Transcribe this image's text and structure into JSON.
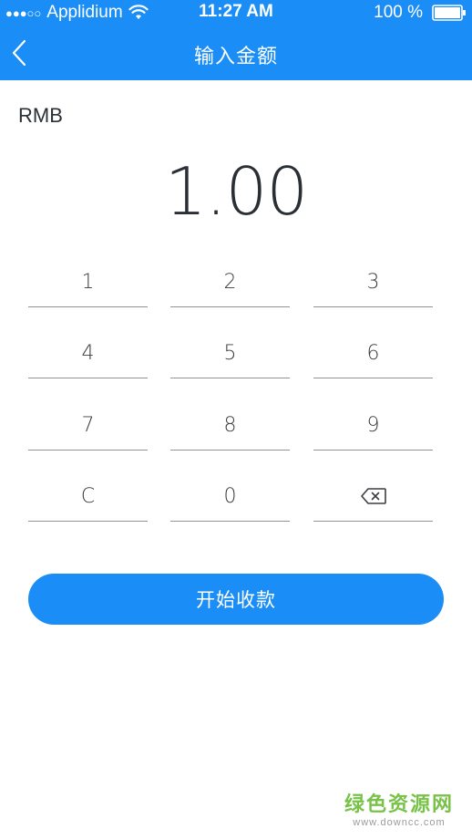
{
  "status_bar": {
    "signal": "●●●○○",
    "carrier": "Applidium",
    "time": "11:27 AM",
    "battery_text": "100 %"
  },
  "nav": {
    "title": "输入金额"
  },
  "currency": "RMB",
  "amount": "1.00",
  "keypad": {
    "keys": [
      "1",
      "2",
      "3",
      "4",
      "5",
      "6",
      "7",
      "8",
      "9",
      "C",
      "0"
    ],
    "backspace_icon": "backspace-icon"
  },
  "start_button": {
    "label": "开始收款"
  },
  "watermark": {
    "main": "绿色资源网",
    "sub": "www.downcc.com"
  },
  "colors": {
    "brand_blue": "#1b8df6",
    "watermark_green": "#79c24a"
  }
}
